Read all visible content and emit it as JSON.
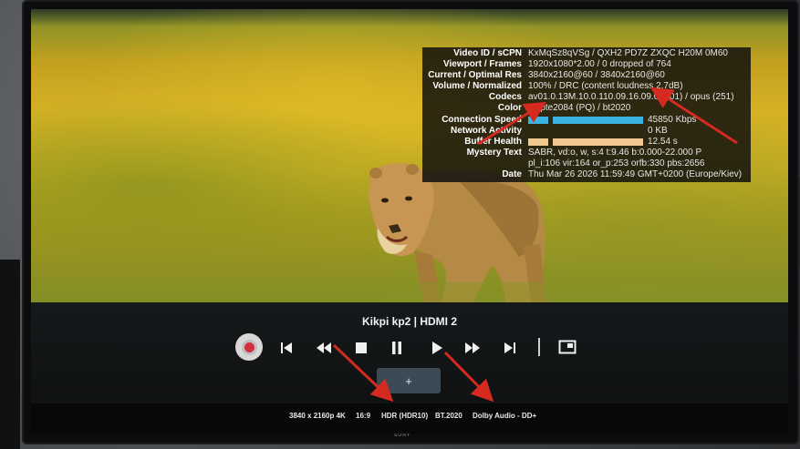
{
  "stats_overlay": {
    "rows": [
      {
        "label": "Video ID / sCPN",
        "value": "KxMqSz8qVSg / QXH2 PD7Z ZXQC H20M 0M60"
      },
      {
        "label": "Viewport / Frames",
        "value": "1920x1080*2.00 / 0 dropped of 764"
      },
      {
        "label": "Current / Optimal Res",
        "value": "3840x2160@60 / 3840x2160@60"
      },
      {
        "label": "Volume / Normalized",
        "value": "100% / DRC (content loudness 2.7dB)"
      },
      {
        "label": "Codecs",
        "value": "av01.0.13M.10.0.110.09.16.09.0 (701) / opus (251)"
      },
      {
        "label": "Color",
        "value": "smpte2084 (PQ) / bt2020"
      },
      {
        "label": "Connection Speed",
        "value": "45850 Kbps"
      },
      {
        "label": "Network Activity",
        "value": "0 KB"
      },
      {
        "label": "Buffer Health",
        "value": "12.54 s"
      },
      {
        "label": "Mystery Text",
        "value": "SABR, vd:o, w, s:4 t:9.46 b:0.000-22.000 P"
      },
      {
        "label": "",
        "value": "pl_i:106 vir:164 or_p:253 orfb:330 pbs:2656"
      },
      {
        "label": "Date",
        "value": "Thu Mar 26 2026 11:59:49 GMT+0200 (Europe/Kiev)"
      }
    ]
  },
  "player": {
    "source_title": "Kikpi kp2  |  HDMI 2",
    "add_label": "+"
  },
  "info_bar": {
    "resolution": "3840 x 2160p 4K",
    "aspect": "16:9",
    "hdr": "HDR (HDR10)",
    "colorspace": "BT.2020",
    "audio": "Dolby Audio - DD+"
  },
  "brand": {
    "logo": "SONY"
  },
  "colors": {
    "arrow": "#d42a20",
    "record": "#d32f3a",
    "bar_blue": "#3ab3e0",
    "bar_orange": "#f0c890"
  },
  "icons": [
    "record-icon",
    "skip-previous-icon",
    "rewind-icon",
    "stop-icon",
    "pause-icon",
    "play-icon",
    "fast-forward-icon",
    "skip-next-icon",
    "picture-in-picture-icon"
  ]
}
